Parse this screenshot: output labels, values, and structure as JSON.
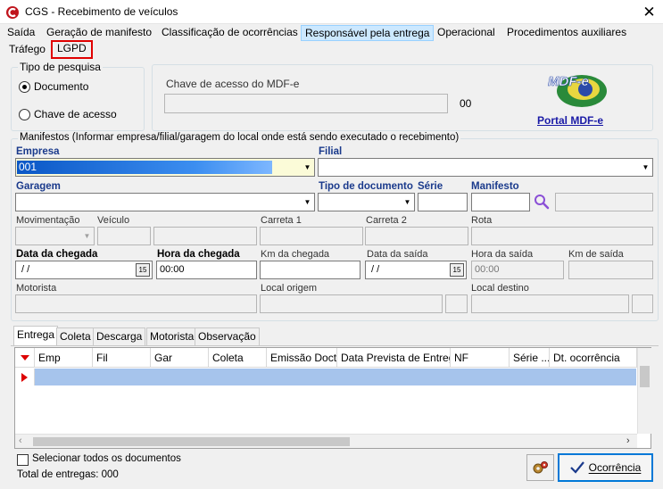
{
  "window": {
    "title": "CGS - Recebimento de veículos",
    "close": "✕"
  },
  "menu": {
    "items": [
      "Saída",
      "Geração de manifesto",
      "Classificação de ocorrências",
      "Responsável pela entrega",
      "Operacional",
      "Procedimentos auxiliares",
      "Tráfego",
      "LGPD"
    ],
    "active": "Responsável pela entrega",
    "highlighted": "LGPD"
  },
  "search_type": {
    "legend": "Tipo de pesquisa",
    "opt_documento": "Documento",
    "opt_chave": "Chave de acesso",
    "selected": "Documento"
  },
  "mdfe": {
    "label": "Chave de acesso do MDF-e",
    "value": "",
    "counter": "00",
    "logo_text": "MDF-e",
    "portal_link": "Portal MDF-e"
  },
  "manifest_group": {
    "legend": "Manifestos (Informar empresa/filial/garagem do local onde está sendo executado o recebimento)"
  },
  "fields": {
    "empresa_label": "Empresa",
    "empresa_value": "001",
    "filial_label": "Filial",
    "garagem_label": "Garagem",
    "tipo_doc_label": "Tipo de documento",
    "serie_label": "Série",
    "manifesto_label": "Manifesto",
    "movimentacao_label": "Movimentação",
    "veiculo_label": "Veículo",
    "carreta1_label": "Carreta 1",
    "carreta2_label": "Carreta 2",
    "rota_label": "Rota",
    "data_chegada_label": "Data da chegada",
    "data_chegada_value": " / /",
    "hora_chegada_label": "Hora da chegada",
    "hora_chegada_value": "00:00",
    "km_chegada_label": "Km da chegada",
    "data_saida_label": "Data da saída",
    "data_saida_value": " / /",
    "hora_saida_label": "Hora da saída",
    "hora_saida_value": "00:00",
    "km_saida_label": "Km de saída",
    "motorista_label": "Motorista",
    "local_origem_label": "Local origem",
    "local_destino_label": "Local destino",
    "calendar_glyph": "15"
  },
  "tabs": [
    "Entrega",
    "Coleta",
    "Descarga",
    "Motorista",
    "Observação"
  ],
  "active_tab": "Entrega",
  "grid": {
    "columns": [
      "Emp",
      "Fil",
      "Gar",
      "Coleta",
      "Emissão Docto",
      "Data Prevista de Entrega",
      "NF",
      "Série ...",
      "Dt. ocorrência"
    ],
    "rows": []
  },
  "footer": {
    "select_all": "Selecionar todos os documentos",
    "total": "Total de entregas: 000",
    "ocorrencia_button": "Ocorrência"
  },
  "colors": {
    "accent": "#0078d7",
    "highlight_red": "#e00000",
    "selected_row": "#a6c4ec",
    "menu_active": "#cce8ff"
  }
}
